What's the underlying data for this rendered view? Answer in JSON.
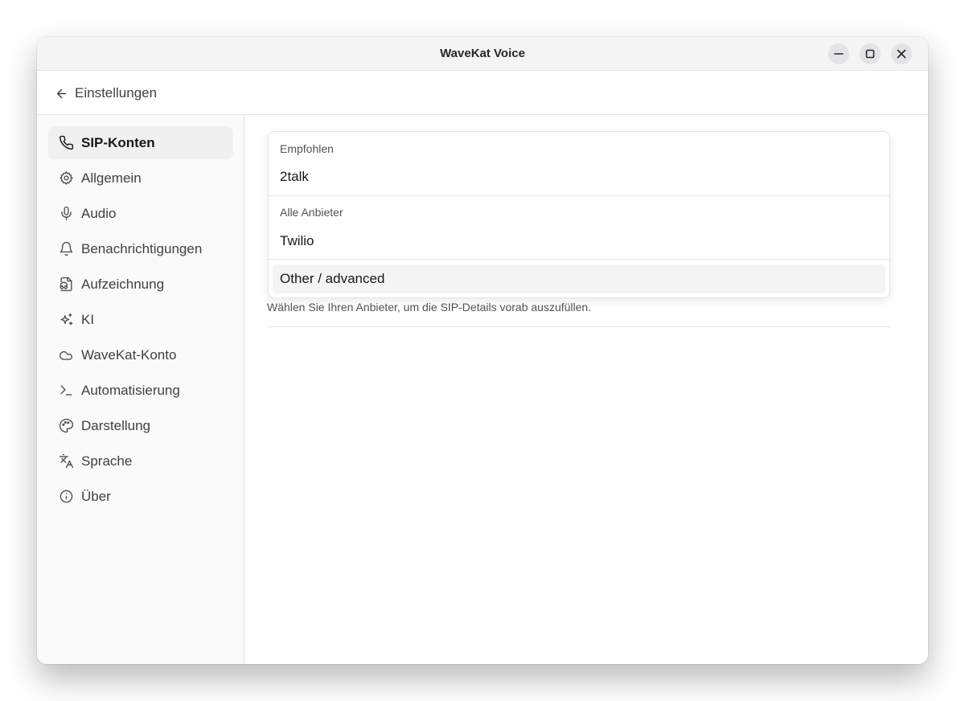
{
  "window": {
    "title": "WaveKat Voice"
  },
  "header": {
    "back_label": "Einstellungen"
  },
  "sidebar": {
    "items": [
      {
        "label": "SIP-Konten",
        "icon": "phone-icon",
        "active": true
      },
      {
        "label": "Allgemein",
        "icon": "gear-icon",
        "active": false
      },
      {
        "label": "Audio",
        "icon": "microphone-icon",
        "active": false
      },
      {
        "label": "Benachrichtigungen",
        "icon": "bell-icon",
        "active": false
      },
      {
        "label": "Aufzeichnung",
        "icon": "file-audio-icon",
        "active": false
      },
      {
        "label": "KI",
        "icon": "sparkles-icon",
        "active": false
      },
      {
        "label": "WaveKat-Konto",
        "icon": "cloud-icon",
        "active": false
      },
      {
        "label": "Automatisierung",
        "icon": "terminal-icon",
        "active": false
      },
      {
        "label": "Darstellung",
        "icon": "palette-icon",
        "active": false
      },
      {
        "label": "Sprache",
        "icon": "languages-icon",
        "active": false
      },
      {
        "label": "Über",
        "icon": "info-icon",
        "active": false
      }
    ]
  },
  "provider_dropdown": {
    "groups": [
      {
        "label": "Empfohlen",
        "items": [
          "2talk"
        ]
      },
      {
        "label": "Alle Anbieter",
        "items": [
          "Twilio"
        ]
      }
    ],
    "highlighted_item": "Other / advanced"
  },
  "provider_helper": "Wählen Sie Ihren Anbieter, um die SIP-Details vorab auszufüllen."
}
